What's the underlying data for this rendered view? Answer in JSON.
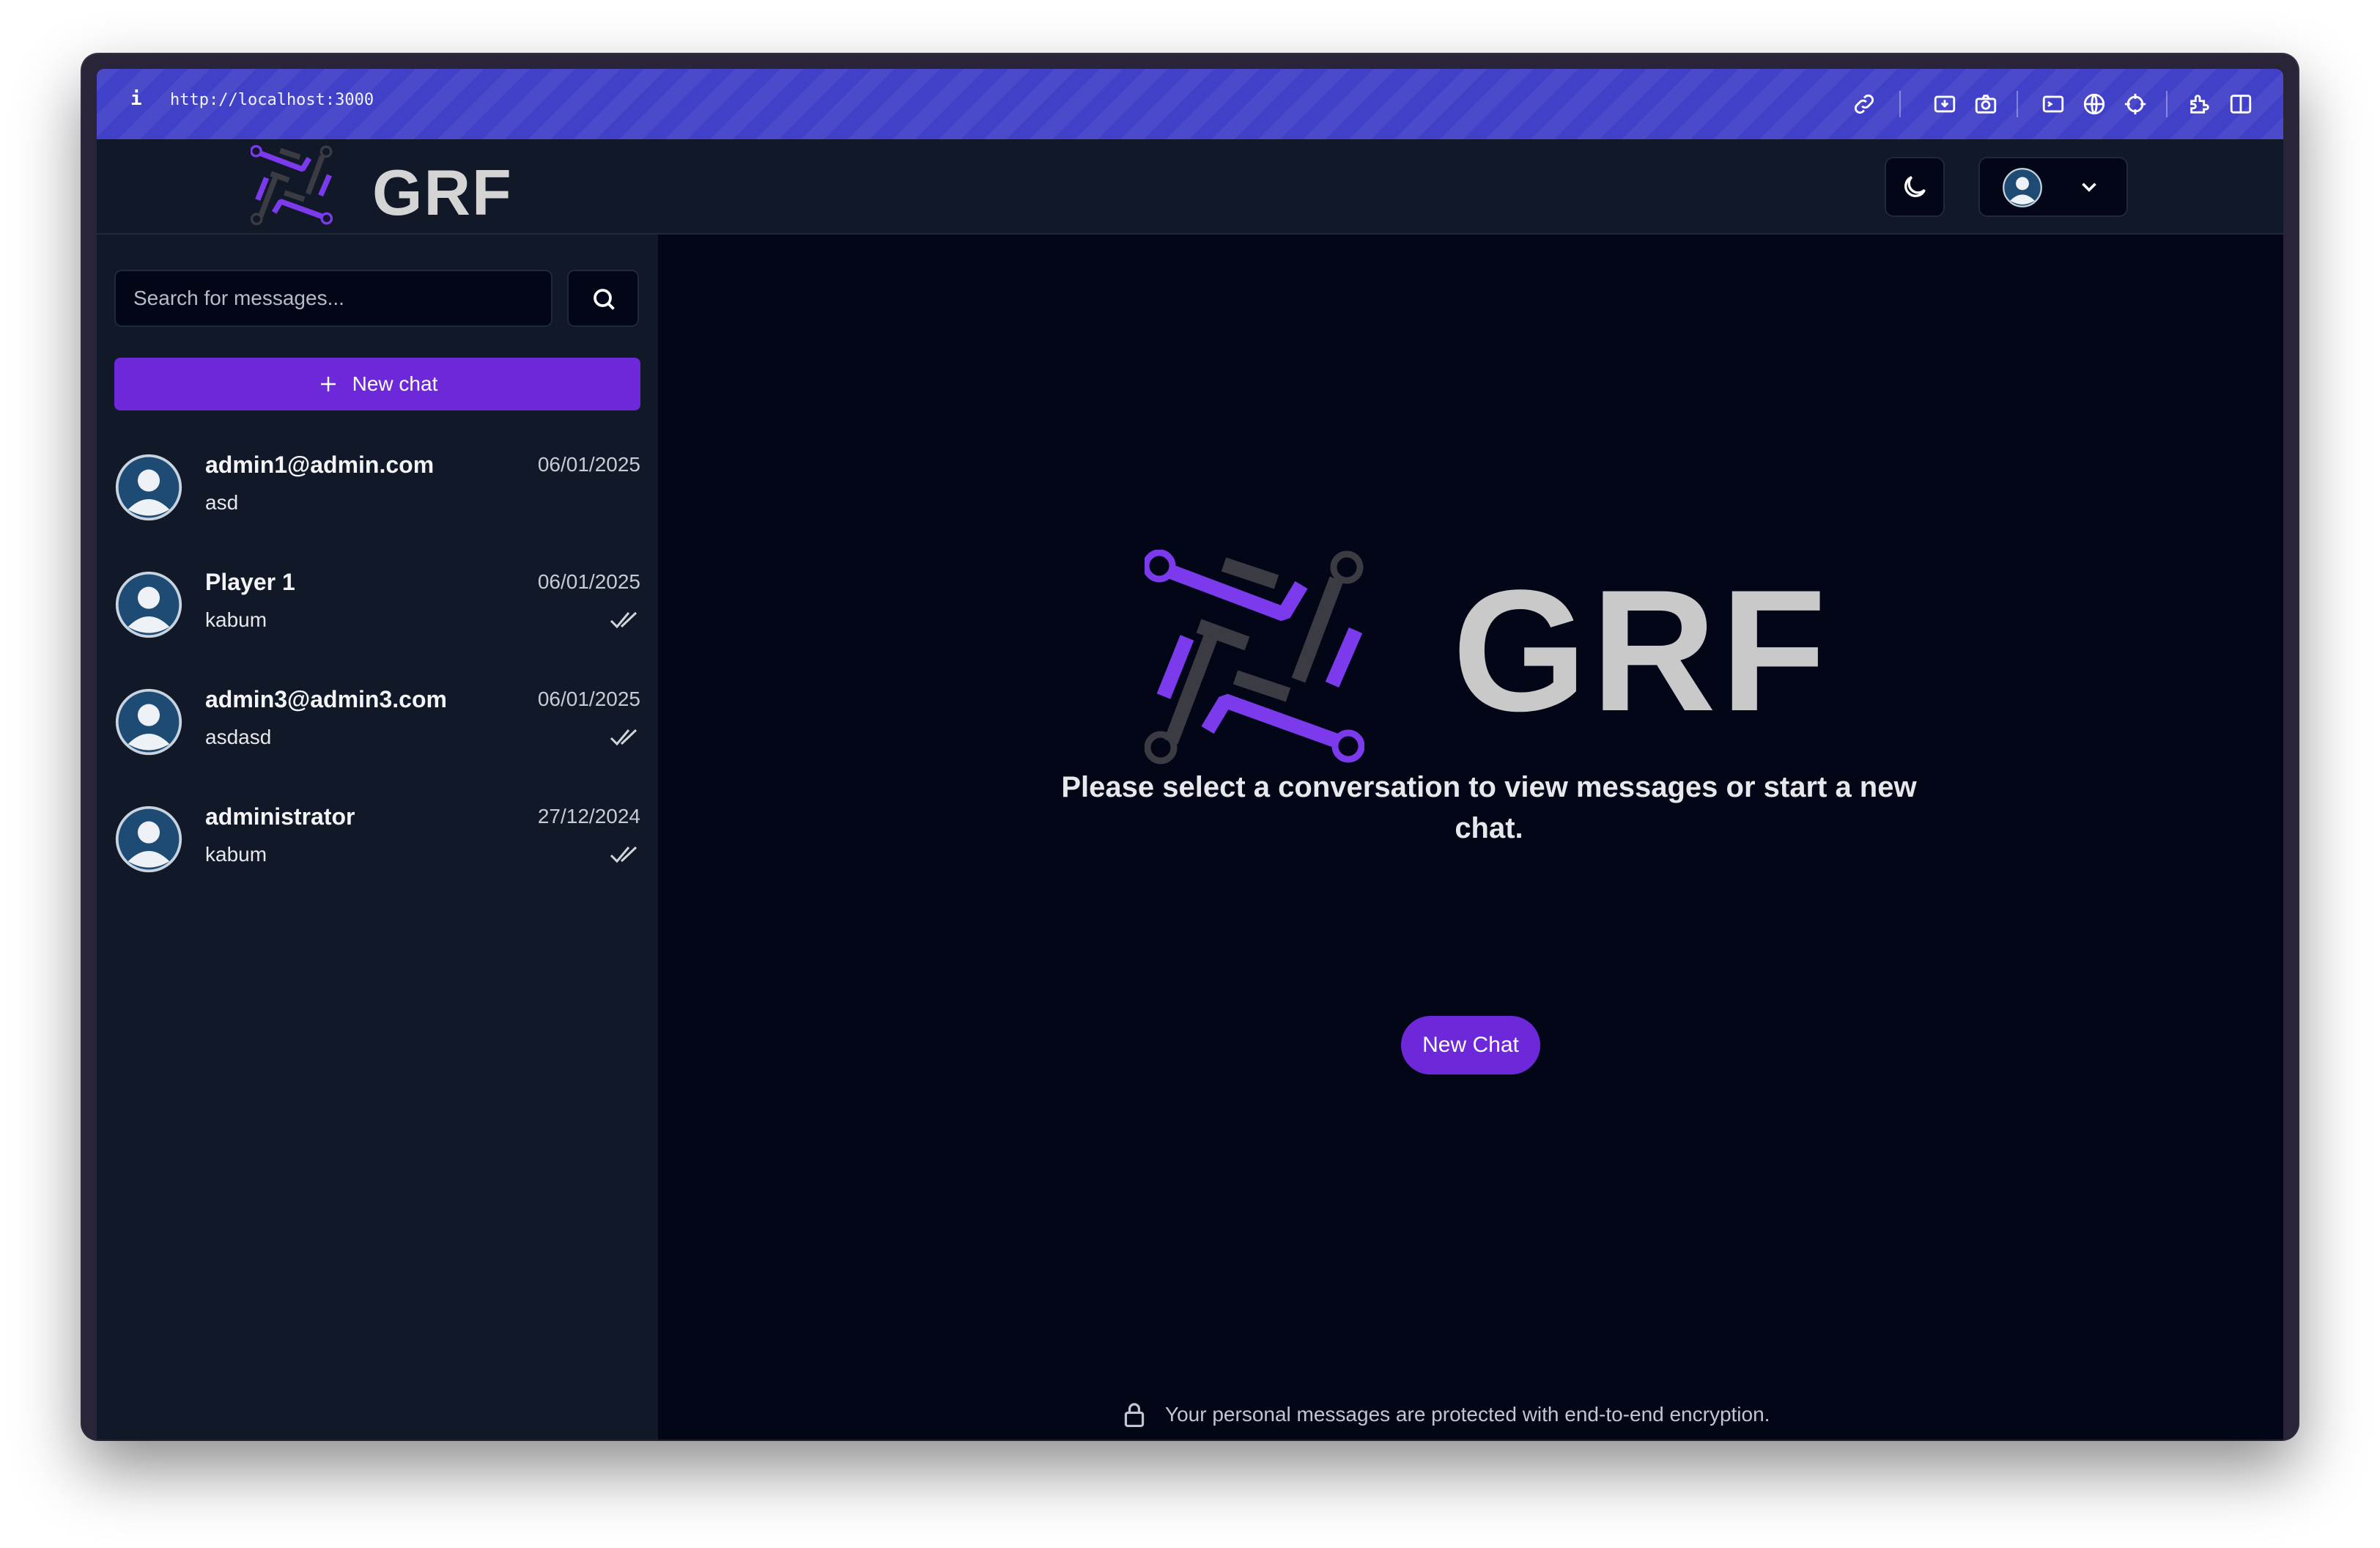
{
  "browser": {
    "info_glyph": "i",
    "url": "http://localhost:3000"
  },
  "header": {
    "brand": "GRF"
  },
  "sidebar": {
    "search_placeholder": "Search for messages...",
    "new_chat_label": "New chat",
    "conversations": [
      {
        "name": "admin1@admin.com",
        "date": "06/01/2025",
        "preview": "asd",
        "read_receipt": false
      },
      {
        "name": "Player 1",
        "date": "06/01/2025",
        "preview": "kabum",
        "read_receipt": true
      },
      {
        "name": "admin3@admin3.com",
        "date": "06/01/2025",
        "preview": "asdasd",
        "read_receipt": true
      },
      {
        "name": "administrator",
        "date": "27/12/2024",
        "preview": "kabum",
        "read_receipt": true
      }
    ]
  },
  "main": {
    "brand": "GRF",
    "prompt": "Please select a conversation to view messages or start a new chat.",
    "cta_label": "New Chat",
    "footer_text": "Your personal messages are protected with end-to-end encryption."
  },
  "colors": {
    "accent": "#6d28d9",
    "browser_bar": "#4040c8",
    "sidebar_bg": "#111827",
    "main_bg": "#020617"
  },
  "icons": [
    "link-icon",
    "download-icon",
    "camera-icon",
    "terminal-icon",
    "globe-icon",
    "crosshair-icon",
    "extensions-icon",
    "split-view-icon",
    "moon-icon",
    "avatar-icon",
    "chevron-down-icon",
    "search-icon",
    "plus-icon",
    "double-check-icon",
    "lock-icon"
  ]
}
